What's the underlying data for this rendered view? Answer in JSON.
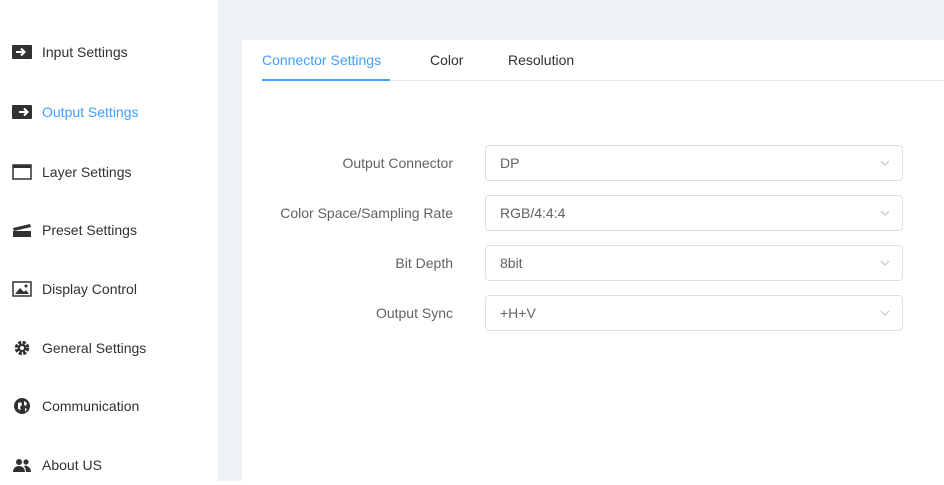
{
  "sidebar": {
    "items": [
      {
        "label": "Input Settings",
        "icon": "input-arrow-icon"
      },
      {
        "label": "Output Settings",
        "icon": "output-arrow-icon",
        "active": true
      },
      {
        "label": "Layer Settings",
        "icon": "window-icon"
      },
      {
        "label": "Preset Settings",
        "icon": "clapper-icon"
      },
      {
        "label": "Display Control",
        "icon": "image-icon"
      },
      {
        "label": "General Settings",
        "icon": "gear-icon"
      },
      {
        "label": "Communication",
        "icon": "globe-icon"
      },
      {
        "label": "About US",
        "icon": "users-icon"
      }
    ]
  },
  "tabs": [
    {
      "label": "Connector Settings",
      "active": true
    },
    {
      "label": "Color"
    },
    {
      "label": "Resolution"
    }
  ],
  "form": {
    "fields": [
      {
        "label": "Output Connector",
        "value": "DP"
      },
      {
        "label": "Color Space/Sampling Rate",
        "value": "RGB/4:4:4"
      },
      {
        "label": "Bit Depth",
        "value": "8bit"
      },
      {
        "label": "Output Sync",
        "value": "+H+V"
      }
    ]
  },
  "colors": {
    "accent": "#409eff",
    "background": "#eef1f6",
    "text": "#303133"
  }
}
